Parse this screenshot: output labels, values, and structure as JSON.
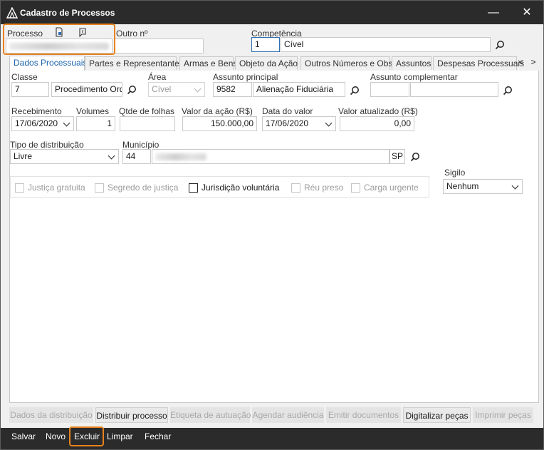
{
  "window": {
    "title": "Cadastro de Processos",
    "minimize_symbol": "—",
    "close_symbol": "✕"
  },
  "header": {
    "processo_label": "Processo",
    "outro_label": "Outro nº",
    "competencia_label": "Competência",
    "competencia_code": "1",
    "competencia_name": "Cível"
  },
  "tabs": [
    {
      "label": "Dados Processuais"
    },
    {
      "label": "Partes e Representantes"
    },
    {
      "label": "Armas e Bens"
    },
    {
      "label": "Objeto da Ação"
    },
    {
      "label": "Outros Números e Obs."
    },
    {
      "label": "Assuntos"
    },
    {
      "label": "Despesas Processuais"
    }
  ],
  "tab_nav": {
    "prev": "<",
    "next": ">"
  },
  "form": {
    "classe_label": "Classe",
    "classe_code": "7",
    "classe_name": "Procedimento Ordi",
    "area_label": "Área",
    "area_value": "Cível",
    "assunto_principal_label": "Assunto principal",
    "assunto_principal_code": "9582",
    "assunto_principal_name": "Alienação Fiduciária",
    "assunto_complementar_label": "Assunto complementar",
    "recebimento_label": "Recebimento",
    "recebimento_value": "17/06/2020",
    "volumes_label": "Volumes",
    "volumes_value": "1",
    "qtde_folhas_label": "Qtde de folhas",
    "valor_acao_label": "Valor da ação (R$)",
    "valor_acao_value": "150.000,00",
    "data_valor_label": "Data do valor",
    "data_valor_value": "17/06/2020",
    "valor_atualizado_label": "Valor atualizado (R$)",
    "valor_atualizado_value": "0,00",
    "tipo_distribuicao_label": "Tipo de distribuição",
    "tipo_distribuicao_value": "Livre",
    "municipio_label": "Município",
    "municipio_code": "44",
    "municipio_uf": "SP",
    "sigilo_label": "Sigilo",
    "sigilo_value": "Nenhum"
  },
  "checkboxes": [
    {
      "label": "Justiça gratuita",
      "checked": false,
      "enabled": false
    },
    {
      "label": "Segredo de justiça",
      "checked": false,
      "enabled": false
    },
    {
      "label": "Jurisdição voluntária",
      "checked": false,
      "enabled": true
    },
    {
      "label": "Réu preso",
      "checked": false,
      "enabled": false
    },
    {
      "label": "Carga urgente",
      "checked": false,
      "enabled": false
    }
  ],
  "actions": [
    {
      "label": "Dados da distribuição",
      "enabled": false
    },
    {
      "label": "Distribuir processo",
      "enabled": true
    },
    {
      "label": "Etiqueta de autuação",
      "enabled": false
    },
    {
      "label": "Agendar audiência",
      "enabled": false
    },
    {
      "label": "Emitir documentos",
      "enabled": false
    },
    {
      "label": "Digitalizar peças",
      "enabled": true
    },
    {
      "label": "Imprimir peças",
      "enabled": false
    }
  ],
  "bottom_buttons": [
    {
      "label": "Salvar"
    },
    {
      "label": "Novo"
    },
    {
      "label": "Excluir"
    },
    {
      "label": "Limpar"
    },
    {
      "label": "Fechar"
    }
  ],
  "colors": {
    "titlebar": "#2b2b2b",
    "highlight": "#e8821e",
    "active_tab_text": "#1b64b0"
  },
  "icons": [
    "app-icon",
    "document-icon",
    "note-icon",
    "search-icon",
    "chevron-down-icon"
  ]
}
